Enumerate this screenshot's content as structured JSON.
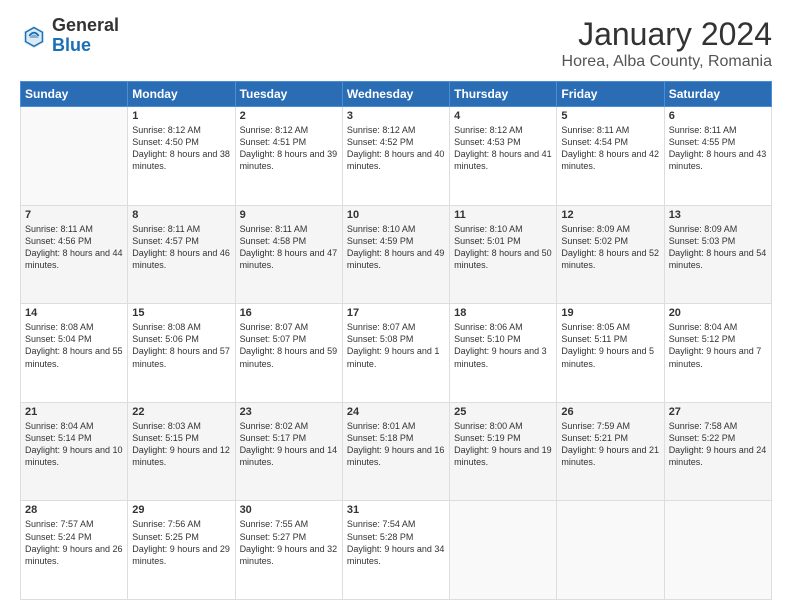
{
  "header": {
    "logo_general": "General",
    "logo_blue": "Blue",
    "title": "January 2024",
    "subtitle": "Horea, Alba County, Romania"
  },
  "weekdays": [
    "Sunday",
    "Monday",
    "Tuesday",
    "Wednesday",
    "Thursday",
    "Friday",
    "Saturday"
  ],
  "weeks": [
    [
      {
        "day": "",
        "sunrise": "",
        "sunset": "",
        "daylight": ""
      },
      {
        "day": "1",
        "sunrise": "Sunrise: 8:12 AM",
        "sunset": "Sunset: 4:50 PM",
        "daylight": "Daylight: 8 hours and 38 minutes."
      },
      {
        "day": "2",
        "sunrise": "Sunrise: 8:12 AM",
        "sunset": "Sunset: 4:51 PM",
        "daylight": "Daylight: 8 hours and 39 minutes."
      },
      {
        "day": "3",
        "sunrise": "Sunrise: 8:12 AM",
        "sunset": "Sunset: 4:52 PM",
        "daylight": "Daylight: 8 hours and 40 minutes."
      },
      {
        "day": "4",
        "sunrise": "Sunrise: 8:12 AM",
        "sunset": "Sunset: 4:53 PM",
        "daylight": "Daylight: 8 hours and 41 minutes."
      },
      {
        "day": "5",
        "sunrise": "Sunrise: 8:11 AM",
        "sunset": "Sunset: 4:54 PM",
        "daylight": "Daylight: 8 hours and 42 minutes."
      },
      {
        "day": "6",
        "sunrise": "Sunrise: 8:11 AM",
        "sunset": "Sunset: 4:55 PM",
        "daylight": "Daylight: 8 hours and 43 minutes."
      }
    ],
    [
      {
        "day": "7",
        "sunrise": "Sunrise: 8:11 AM",
        "sunset": "Sunset: 4:56 PM",
        "daylight": "Daylight: 8 hours and 44 minutes."
      },
      {
        "day": "8",
        "sunrise": "Sunrise: 8:11 AM",
        "sunset": "Sunset: 4:57 PM",
        "daylight": "Daylight: 8 hours and 46 minutes."
      },
      {
        "day": "9",
        "sunrise": "Sunrise: 8:11 AM",
        "sunset": "Sunset: 4:58 PM",
        "daylight": "Daylight: 8 hours and 47 minutes."
      },
      {
        "day": "10",
        "sunrise": "Sunrise: 8:10 AM",
        "sunset": "Sunset: 4:59 PM",
        "daylight": "Daylight: 8 hours and 49 minutes."
      },
      {
        "day": "11",
        "sunrise": "Sunrise: 8:10 AM",
        "sunset": "Sunset: 5:01 PM",
        "daylight": "Daylight: 8 hours and 50 minutes."
      },
      {
        "day": "12",
        "sunrise": "Sunrise: 8:09 AM",
        "sunset": "Sunset: 5:02 PM",
        "daylight": "Daylight: 8 hours and 52 minutes."
      },
      {
        "day": "13",
        "sunrise": "Sunrise: 8:09 AM",
        "sunset": "Sunset: 5:03 PM",
        "daylight": "Daylight: 8 hours and 54 minutes."
      }
    ],
    [
      {
        "day": "14",
        "sunrise": "Sunrise: 8:08 AM",
        "sunset": "Sunset: 5:04 PM",
        "daylight": "Daylight: 8 hours and 55 minutes."
      },
      {
        "day": "15",
        "sunrise": "Sunrise: 8:08 AM",
        "sunset": "Sunset: 5:06 PM",
        "daylight": "Daylight: 8 hours and 57 minutes."
      },
      {
        "day": "16",
        "sunrise": "Sunrise: 8:07 AM",
        "sunset": "Sunset: 5:07 PM",
        "daylight": "Daylight: 8 hours and 59 minutes."
      },
      {
        "day": "17",
        "sunrise": "Sunrise: 8:07 AM",
        "sunset": "Sunset: 5:08 PM",
        "daylight": "Daylight: 9 hours and 1 minute."
      },
      {
        "day": "18",
        "sunrise": "Sunrise: 8:06 AM",
        "sunset": "Sunset: 5:10 PM",
        "daylight": "Daylight: 9 hours and 3 minutes."
      },
      {
        "day": "19",
        "sunrise": "Sunrise: 8:05 AM",
        "sunset": "Sunset: 5:11 PM",
        "daylight": "Daylight: 9 hours and 5 minutes."
      },
      {
        "day": "20",
        "sunrise": "Sunrise: 8:04 AM",
        "sunset": "Sunset: 5:12 PM",
        "daylight": "Daylight: 9 hours and 7 minutes."
      }
    ],
    [
      {
        "day": "21",
        "sunrise": "Sunrise: 8:04 AM",
        "sunset": "Sunset: 5:14 PM",
        "daylight": "Daylight: 9 hours and 10 minutes."
      },
      {
        "day": "22",
        "sunrise": "Sunrise: 8:03 AM",
        "sunset": "Sunset: 5:15 PM",
        "daylight": "Daylight: 9 hours and 12 minutes."
      },
      {
        "day": "23",
        "sunrise": "Sunrise: 8:02 AM",
        "sunset": "Sunset: 5:17 PM",
        "daylight": "Daylight: 9 hours and 14 minutes."
      },
      {
        "day": "24",
        "sunrise": "Sunrise: 8:01 AM",
        "sunset": "Sunset: 5:18 PM",
        "daylight": "Daylight: 9 hours and 16 minutes."
      },
      {
        "day": "25",
        "sunrise": "Sunrise: 8:00 AM",
        "sunset": "Sunset: 5:19 PM",
        "daylight": "Daylight: 9 hours and 19 minutes."
      },
      {
        "day": "26",
        "sunrise": "Sunrise: 7:59 AM",
        "sunset": "Sunset: 5:21 PM",
        "daylight": "Daylight: 9 hours and 21 minutes."
      },
      {
        "day": "27",
        "sunrise": "Sunrise: 7:58 AM",
        "sunset": "Sunset: 5:22 PM",
        "daylight": "Daylight: 9 hours and 24 minutes."
      }
    ],
    [
      {
        "day": "28",
        "sunrise": "Sunrise: 7:57 AM",
        "sunset": "Sunset: 5:24 PM",
        "daylight": "Daylight: 9 hours and 26 minutes."
      },
      {
        "day": "29",
        "sunrise": "Sunrise: 7:56 AM",
        "sunset": "Sunset: 5:25 PM",
        "daylight": "Daylight: 9 hours and 29 minutes."
      },
      {
        "day": "30",
        "sunrise": "Sunrise: 7:55 AM",
        "sunset": "Sunset: 5:27 PM",
        "daylight": "Daylight: 9 hours and 32 minutes."
      },
      {
        "day": "31",
        "sunrise": "Sunrise: 7:54 AM",
        "sunset": "Sunset: 5:28 PM",
        "daylight": "Daylight: 9 hours and 34 minutes."
      },
      {
        "day": "",
        "sunrise": "",
        "sunset": "",
        "daylight": ""
      },
      {
        "day": "",
        "sunrise": "",
        "sunset": "",
        "daylight": ""
      },
      {
        "day": "",
        "sunrise": "",
        "sunset": "",
        "daylight": ""
      }
    ]
  ]
}
